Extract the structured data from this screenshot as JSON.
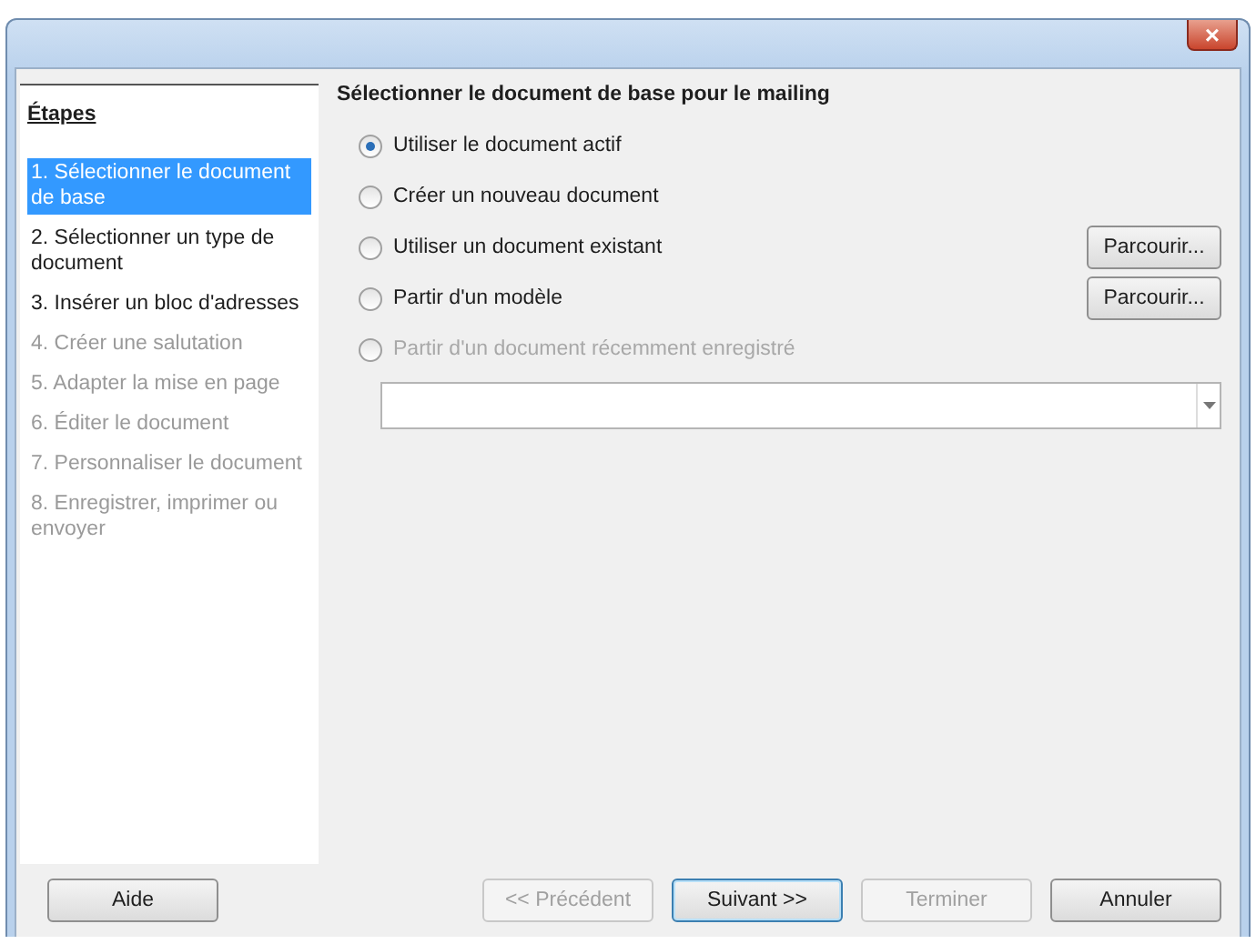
{
  "window": {
    "close_label": "×"
  },
  "sidebar": {
    "title": "Étapes",
    "steps": [
      {
        "label": "1. Sélectionner le document de base",
        "selected": true,
        "disabled": false
      },
      {
        "label": "2. Sélectionner un type de document",
        "selected": false,
        "disabled": false
      },
      {
        "label": "3. Insérer un bloc d'adresses",
        "selected": false,
        "disabled": false
      },
      {
        "label": "4. Créer une salutation",
        "selected": false,
        "disabled": true
      },
      {
        "label": "5. Adapter la mise en page",
        "selected": false,
        "disabled": true
      },
      {
        "label": "6. Éditer le document",
        "selected": false,
        "disabled": true
      },
      {
        "label": "7. Personnaliser le document",
        "selected": false,
        "disabled": true
      },
      {
        "label": "8. Enregistrer, imprimer ou envoyer",
        "selected": false,
        "disabled": true
      }
    ]
  },
  "content": {
    "heading": "Sélectionner le document de base pour le mailing",
    "options": [
      {
        "label": "Utiliser le document actif",
        "selected": true,
        "disabled": false
      },
      {
        "label": "Créer un nouveau document",
        "selected": false,
        "disabled": false
      },
      {
        "label": "Utiliser un document existant",
        "selected": false,
        "disabled": false,
        "button": "Parcourir..."
      },
      {
        "label": "Partir d'un modèle",
        "selected": false,
        "disabled": false,
        "button": "Parcourir..."
      },
      {
        "label": "Partir d'un document récemment enregistré",
        "selected": false,
        "disabled": true
      }
    ]
  },
  "footer": {
    "help": "Aide",
    "buttons": [
      {
        "label": "<< Précédent",
        "disabled": true,
        "default": false
      },
      {
        "label": "Suivant >>",
        "disabled": false,
        "default": true
      },
      {
        "label": "Terminer",
        "disabled": true,
        "default": false
      },
      {
        "label": "Annuler",
        "disabled": false,
        "default": false
      }
    ]
  }
}
